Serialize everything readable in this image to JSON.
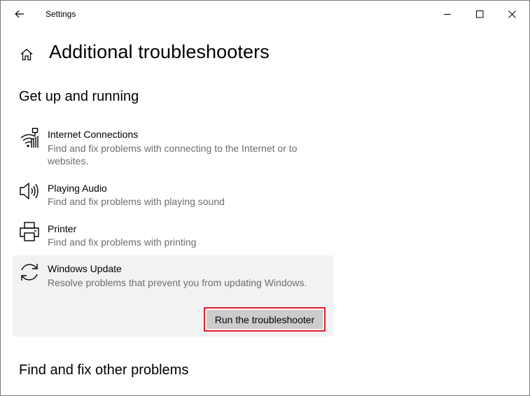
{
  "window": {
    "title": "Settings"
  },
  "page": {
    "title": "Additional troubleshooters"
  },
  "sections": {
    "get_up_running": "Get up and running",
    "find_fix_other": "Find and fix other problems"
  },
  "items": [
    {
      "name": "Internet Connections",
      "desc_line1": "Find and fix problems with connecting to the Internet or to",
      "desc_line2": "websites.",
      "icon": "wifi-icon"
    },
    {
      "name": "Playing Audio",
      "desc_line1": "Find and fix problems with playing sound",
      "icon": "speaker-icon"
    },
    {
      "name": "Printer",
      "desc_line1": "Find and fix problems with printing",
      "icon": "printer-icon"
    },
    {
      "name": "Windows Update",
      "desc_line1": "Resolve problems that prevent you from updating Windows.",
      "icon": "refresh-icon"
    }
  ],
  "run_button": {
    "label": "Run the troubleshooter"
  },
  "colors": {
    "selected_bg": "#f2f2f2",
    "button_bg": "#cccccc",
    "highlight_border": "#e0202a",
    "desc_text": "#6e6e6e"
  }
}
